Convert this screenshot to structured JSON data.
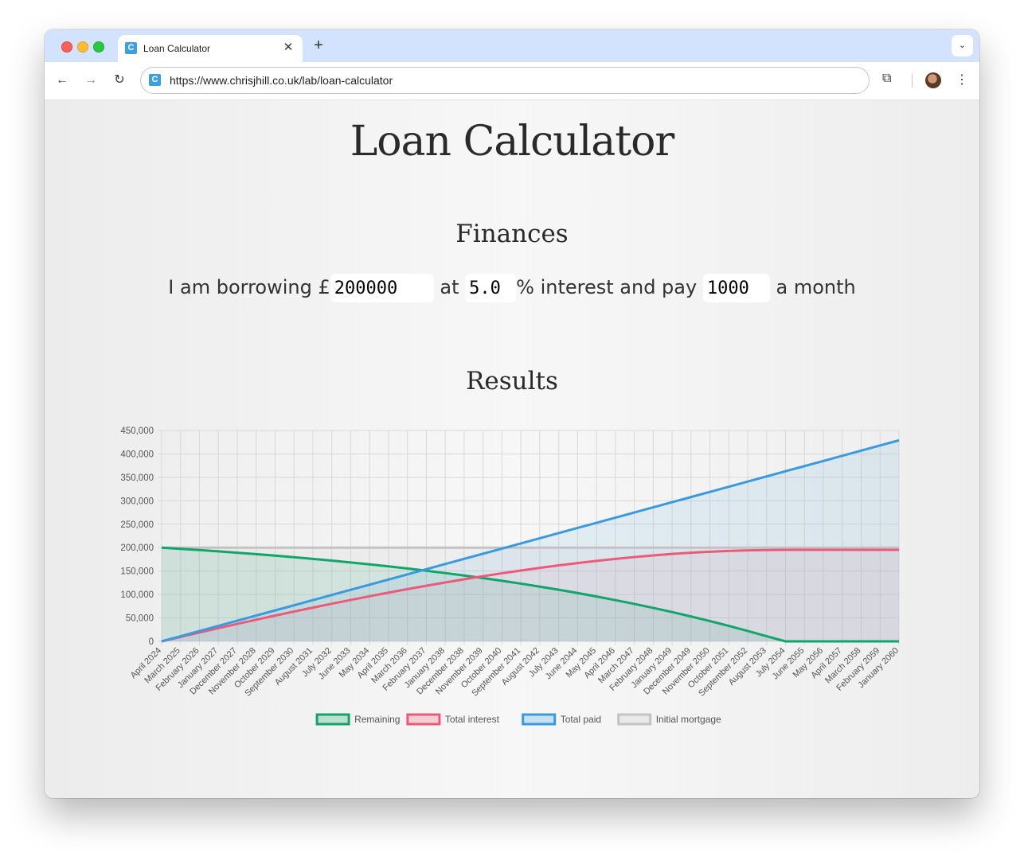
{
  "browser": {
    "tab_title": "Loan Calculator",
    "tab_icon": "C",
    "url": "https://www.chrisjhill.co.uk/lab/loan-calculator",
    "icons": [
      "back-icon",
      "forward-icon",
      "reload-icon",
      "extensions-icon",
      "profile-avatar",
      "kebab-menu-icon",
      "tab-close-icon",
      "new-tab-icon",
      "tab-list-icon"
    ]
  },
  "page": {
    "title": "Loan Calculator",
    "finances_heading": "Finances",
    "results_heading": "Results",
    "sentence": {
      "part1": "I am borrowing £",
      "part2": "at",
      "part3": "% interest and pay",
      "part4": "a month"
    },
    "inputs": {
      "amount": "200000",
      "rate": "5.0",
      "payment": "1000"
    }
  },
  "chart_data": {
    "type": "line",
    "x": [
      "April 2024",
      "March 2025",
      "February 2026",
      "January 2027",
      "December 2027",
      "November 2028",
      "October 2029",
      "September 2030",
      "August 2031",
      "July 2032",
      "June 2033",
      "May 2034",
      "April 2035",
      "March 2036",
      "February 2037",
      "January 2038",
      "December 2038",
      "November 2039",
      "October 2040",
      "September 2041",
      "August 2042",
      "July 2043",
      "June 2044",
      "May 2045",
      "April 2046",
      "March 2047",
      "February 2048",
      "January 2049",
      "December 2049",
      "November 2050",
      "October 2051",
      "September 2052",
      "August 2053",
      "July 2054",
      "June 2055",
      "May 2056",
      "April 2057",
      "March 2058",
      "February 2059",
      "January 2060"
    ],
    "ylim": [
      0,
      450000
    ],
    "yticks": [
      0,
      50000,
      100000,
      150000,
      200000,
      250000,
      300000,
      350000,
      400000,
      450000
    ],
    "ytick_labels": [
      "0",
      "50,000",
      "100,000",
      "150,000",
      "200,000",
      "250,000",
      "300,000",
      "350,000",
      "400,000",
      "450,000"
    ],
    "grid": true,
    "legend_position": "bottom",
    "series": [
      {
        "name": "Remaining",
        "color": "#12a56a",
        "fill": "rgba(18,165,106,0.13)",
        "values": [
          200000,
          197500,
          194900,
          192100,
          189200,
          186200,
          183000,
          179600,
          176000,
          172300,
          168400,
          164300,
          160000,
          155500,
          150700,
          145700,
          140500,
          135000,
          129300,
          123200,
          116800,
          110100,
          103100,
          95700,
          88000,
          79900,
          71400,
          62500,
          53100,
          43300,
          33000,
          22200,
          10900,
          0,
          0,
          0,
          0,
          0,
          0,
          0
        ]
      },
      {
        "name": "Total interest",
        "color": "#ec5a7a",
        "fill": "rgba(236,90,122,0.08)",
        "values": [
          0,
          9500,
          18900,
          28100,
          37200,
          46200,
          55000,
          63600,
          72000,
          80300,
          88400,
          96300,
          104000,
          111500,
          118700,
          125700,
          132500,
          139000,
          145300,
          151200,
          156800,
          162100,
          167100,
          171700,
          176000,
          179900,
          183400,
          186500,
          189100,
          191300,
          193000,
          194200,
          194900,
          195200,
          195200,
          195200,
          195200,
          195200,
          195200,
          195200
        ]
      },
      {
        "name": "Total paid",
        "color": "#3a9ade",
        "fill": "rgba(58,154,222,0.11)",
        "values": [
          0,
          11000,
          22000,
          33000,
          44000,
          55000,
          66000,
          77000,
          88000,
          99000,
          110000,
          121000,
          132000,
          143000,
          154000,
          165000,
          176000,
          187000,
          198000,
          209000,
          220000,
          231000,
          242000,
          253000,
          264000,
          275000,
          286000,
          297000,
          308000,
          319000,
          330000,
          341000,
          352000,
          363000,
          374000,
          385000,
          396000,
          407000,
          418000,
          429000
        ]
      },
      {
        "name": "Initial mortgage",
        "color": "#c3c3c3",
        "fill": "rgba(195,195,195,0.15)",
        "values": [
          200000,
          200000,
          200000,
          200000,
          200000,
          200000,
          200000,
          200000,
          200000,
          200000,
          200000,
          200000,
          200000,
          200000,
          200000,
          200000,
          200000,
          200000,
          200000,
          200000,
          200000,
          200000,
          200000,
          200000,
          200000,
          200000,
          200000,
          200000,
          200000,
          200000,
          200000,
          200000,
          200000,
          200000,
          200000,
          200000,
          200000,
          200000,
          200000,
          200000
        ]
      }
    ]
  }
}
